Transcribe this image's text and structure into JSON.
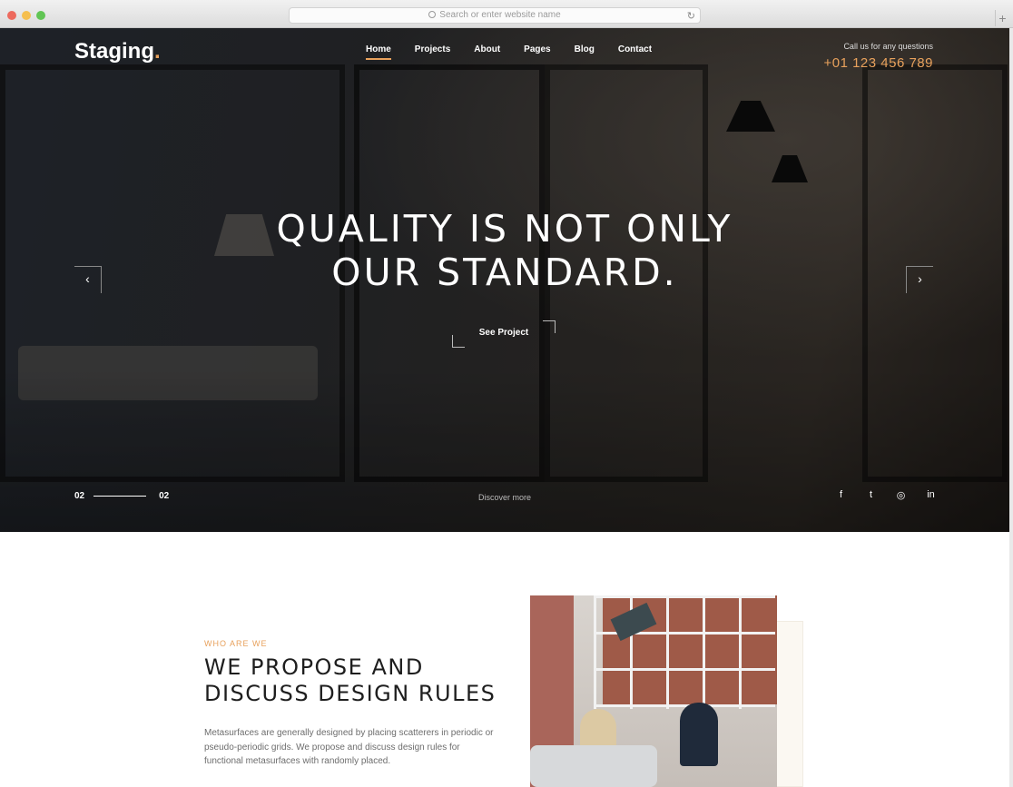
{
  "browser": {
    "url_placeholder": "Search or enter website name",
    "reload_icon": "reload-icon",
    "new_tab_label": "+"
  },
  "header": {
    "logo_text": "Staging",
    "logo_dot": ".",
    "nav": [
      {
        "label": "Home",
        "active": true
      },
      {
        "label": "Projects"
      },
      {
        "label": "About"
      },
      {
        "label": "Pages"
      },
      {
        "label": "Blog"
      },
      {
        "label": "Contact"
      }
    ],
    "call_label": "Call us for any questions",
    "phone": "+01 123 456 789"
  },
  "hero": {
    "headline_line1": "QUALITY IS NOT ONLY",
    "headline_line2": "OUR STANDARD.",
    "cta_label": "See Project",
    "prev_arrow": "‹",
    "next_arrow": "›",
    "counter_current": "02",
    "counter_total": "02",
    "discover_label": "Discover more",
    "social": [
      "f",
      "t",
      "◎",
      "in"
    ]
  },
  "about": {
    "eyebrow": "WHO ARE WE",
    "heading_line1": "WE PROPOSE AND",
    "heading_line2": "DISCUSS DESIGN RULES",
    "body": "Metasurfaces are generally designed by placing scatterers in periodic or pseudo-periodic grids. We propose and discuss design rules for functional metasurfaces with randomly placed."
  },
  "colors": {
    "accent": "#e8a15c",
    "hero_overlay": "#2b2d31",
    "text_dark": "#1e1e1e"
  }
}
